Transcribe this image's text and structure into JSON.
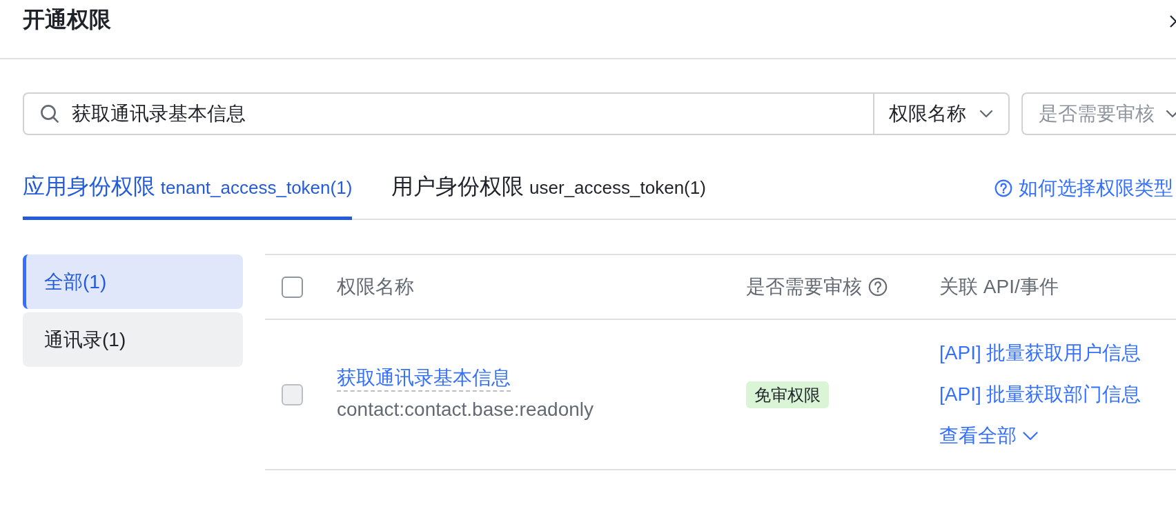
{
  "dialog": {
    "title": "开通权限"
  },
  "search": {
    "value": "获取通讯录基本信息",
    "field_select": "权限名称",
    "filter_select_placeholder": "是否需要审核"
  },
  "tabs": [
    {
      "label": "应用身份权限",
      "token": "tenant_access_token(1)",
      "selected": true
    },
    {
      "label": "用户身份权限",
      "token": "user_access_token(1)",
      "selected": false
    }
  ],
  "help_link": "如何选择权限类型",
  "categories": [
    {
      "label": "全部(1)",
      "selected": true
    },
    {
      "label": "通讯录(1)",
      "selected": false
    }
  ],
  "table": {
    "select_all_checked": false,
    "columns": [
      {
        "label": "权限名称",
        "help_icon": false
      },
      {
        "label": "是否需要审核",
        "help_icon": true
      },
      {
        "label": "关联 API/事件",
        "help_icon": false
      }
    ],
    "rows": [
      {
        "checked": false,
        "disabled": true,
        "name": "获取通讯录基本信息",
        "scope": "contact:contact.base:readonly",
        "review_tag": "免审权限",
        "apis": [
          "[API] 批量获取用户信息",
          "[API] 批量获取部门信息"
        ],
        "show_all": "查看全部"
      }
    ]
  }
}
